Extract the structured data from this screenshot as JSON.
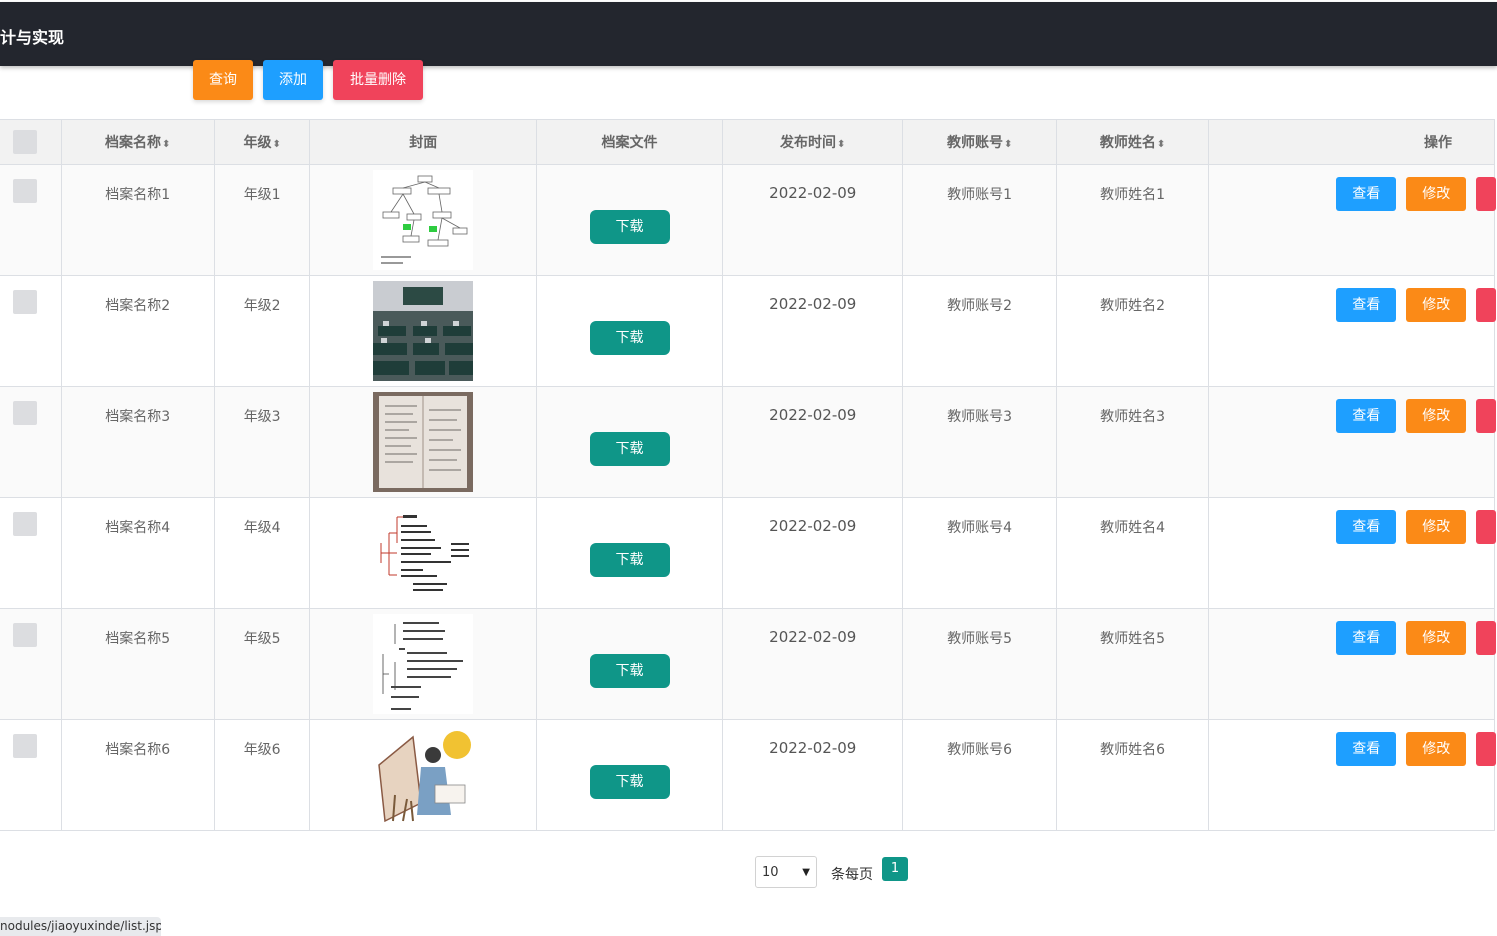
{
  "header": {
    "title": "计与实现"
  },
  "toolbar": {
    "query": "查询",
    "add": "添加",
    "batch_delete": "批量删除"
  },
  "table": {
    "columns": {
      "name": "档案名称",
      "grade": "年级",
      "cover": "封面",
      "file": "档案文件",
      "time": "发布时间",
      "teacher_account": "教师账号",
      "teacher_name": "教师姓名",
      "ops": "操作"
    },
    "sort_glyph": "⬍",
    "rows": [
      {
        "name": "档案名称1",
        "grade": "年级1",
        "download": "下载",
        "time": "2022-02-09",
        "teacher_account": "教师账号1",
        "teacher_name": "教师姓名1",
        "view": "查看",
        "edit": "修改",
        "cover_icon": "flowchart-image"
      },
      {
        "name": "档案名称2",
        "grade": "年级2",
        "download": "下载",
        "time": "2022-02-09",
        "teacher_account": "教师账号2",
        "teacher_name": "教师姓名2",
        "view": "查看",
        "edit": "修改",
        "cover_icon": "classroom-photo"
      },
      {
        "name": "档案名称3",
        "grade": "年级3",
        "download": "下载",
        "time": "2022-02-09",
        "teacher_account": "教师账号3",
        "teacher_name": "教师姓名3",
        "view": "查看",
        "edit": "修改",
        "cover_icon": "notebook-photo"
      },
      {
        "name": "档案名称4",
        "grade": "年级4",
        "download": "下载",
        "time": "2022-02-09",
        "teacher_account": "教师账号4",
        "teacher_name": "教师姓名4",
        "view": "查看",
        "edit": "修改",
        "cover_icon": "mindmap-image"
      },
      {
        "name": "档案名称5",
        "grade": "年级5",
        "download": "下载",
        "time": "2022-02-09",
        "teacher_account": "教师账号5",
        "teacher_name": "教师姓名5",
        "view": "查看",
        "edit": "修改",
        "cover_icon": "outline-image"
      },
      {
        "name": "档案名称6",
        "grade": "年级6",
        "download": "下载",
        "time": "2022-02-09",
        "teacher_account": "教师账号6",
        "teacher_name": "教师姓名6",
        "view": "查看",
        "edit": "修改",
        "cover_icon": "reading-illustration"
      }
    ]
  },
  "pager": {
    "page_size": "10",
    "per_page_label": "条每页",
    "current_page": "1"
  },
  "statusbar": {
    "url": "nodules/jiaoyuxinde/list.jsp"
  },
  "colors": {
    "header_bg": "#23262e",
    "orange": "#fb8a17",
    "blue": "#1e9fff",
    "red": "#f0435b",
    "teal": "#0f9688"
  }
}
